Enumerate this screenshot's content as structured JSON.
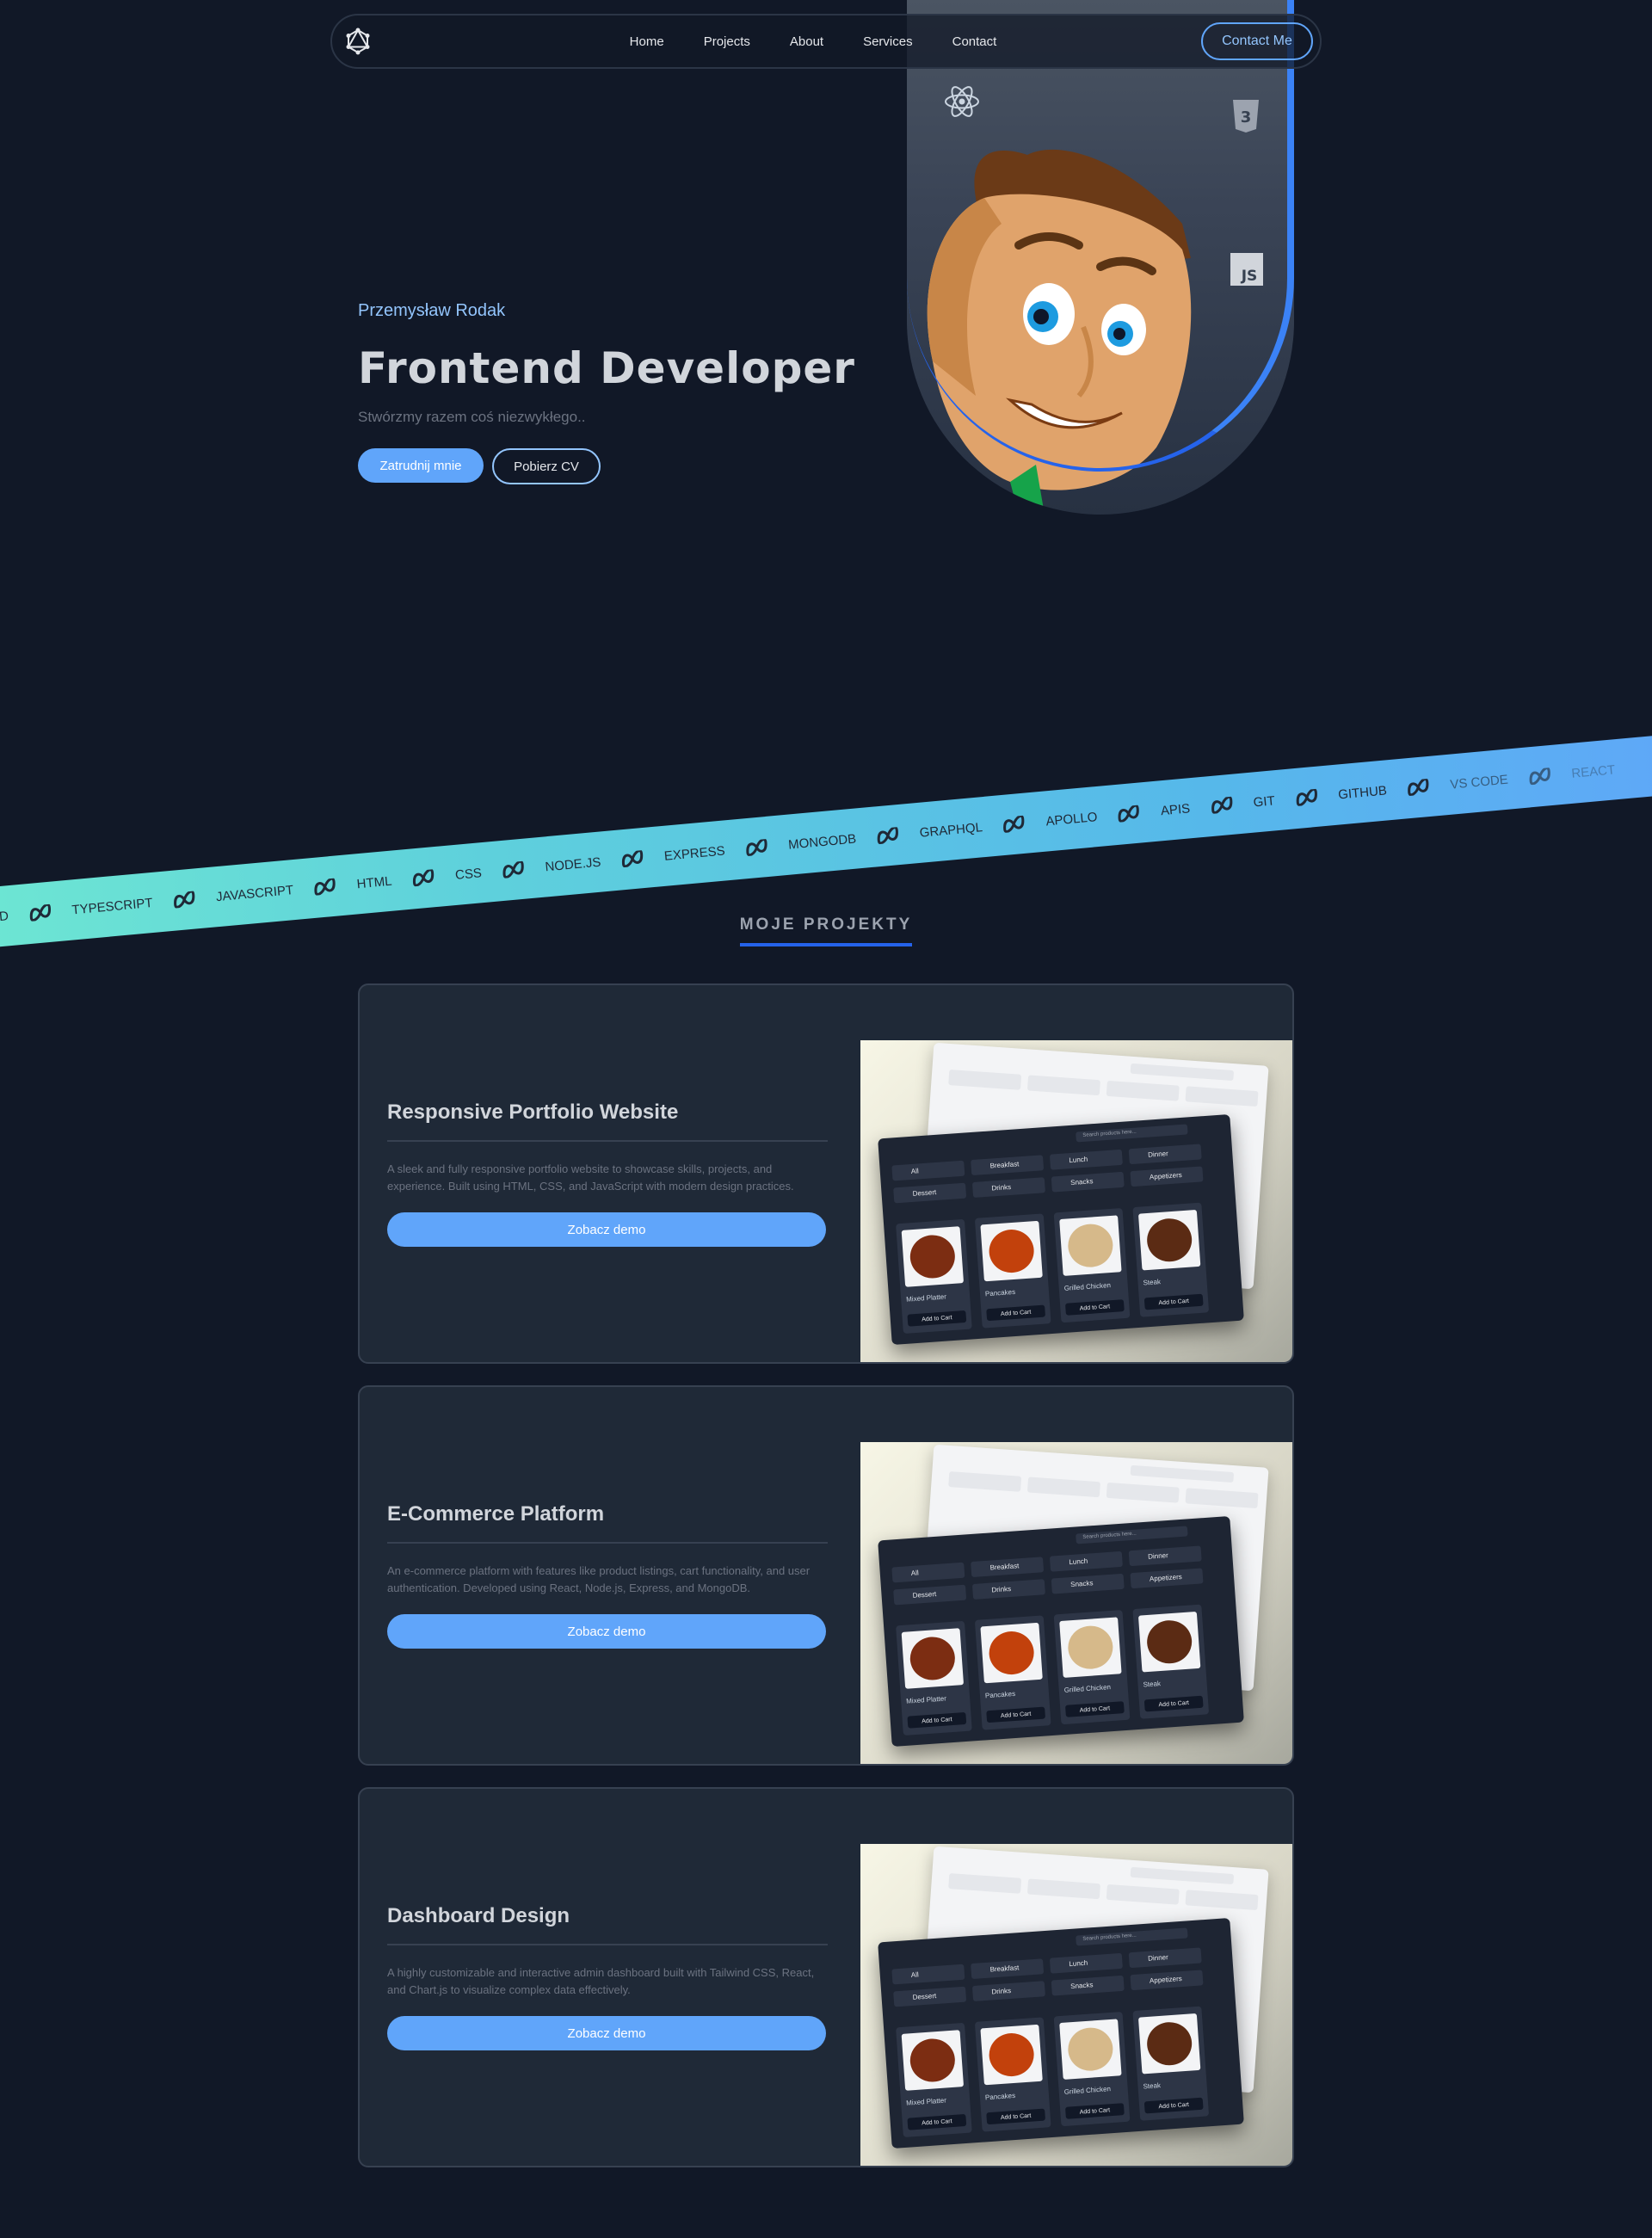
{
  "nav": {
    "logo_icon": "graphql-icon",
    "links": [
      "Home",
      "Projects",
      "About",
      "Services",
      "Contact"
    ],
    "contact_button": "Contact Me"
  },
  "hero": {
    "name": "Przemysław Rodak",
    "title": "Frontend Developer",
    "subtitle": "Stwórzmy razem coś niezwykłego..",
    "primary_button": "Zatrudnij mnie",
    "secondary_button": "Pobierz CV",
    "tech_icons": [
      "react-icon",
      "css3-icon",
      "js-icon"
    ]
  },
  "ribbon": {
    "items": [
      "IND",
      "TYPESCRIPT",
      "JAVASCRIPT",
      "HTML",
      "CSS",
      "NODE.JS",
      "EXPRESS",
      "MONGODB",
      "GRAPHQL",
      "APOLLO",
      "APIS",
      "GIT",
      "GITHUB",
      "VS CODE",
      "REACT"
    ]
  },
  "projects": {
    "heading": "MOJE PROJEKTY",
    "cards": [
      {
        "title": "Responsive Portfolio Website",
        "description": "A sleek and fully responsive portfolio website to showcase skills, projects, and experience. Built using HTML, CSS, and JavaScript with modern design practices.",
        "button": "Zobacz demo"
      },
      {
        "title": "E-Commerce Platform",
        "description": "An e-commerce platform with features like product listings, cart functionality, and user authentication. Developed using React, Node.js, Express, and MongoDB.",
        "button": "Zobacz demo"
      },
      {
        "title": "Dashboard Design",
        "description": "A highly customizable and interactive admin dashboard built with Tailwind CSS, React, and Chart.js to visualize complex data effectively.",
        "button": "Zobacz demo"
      }
    ],
    "screenshot": {
      "search_placeholder": "Search products here...",
      "categories": [
        "All",
        "Breakfast",
        "Lunch",
        "Dinner",
        "Dessert",
        "Drinks",
        "Snacks",
        "Appetizers"
      ],
      "dishes": [
        "Mixed Platter",
        "Pancakes",
        "Grilled Chicken",
        "Steak"
      ],
      "add_to_cart": "Add to Cart"
    }
  },
  "colors": {
    "background": "#111827",
    "accent": "#60a5fa",
    "card": "#1f2937"
  }
}
